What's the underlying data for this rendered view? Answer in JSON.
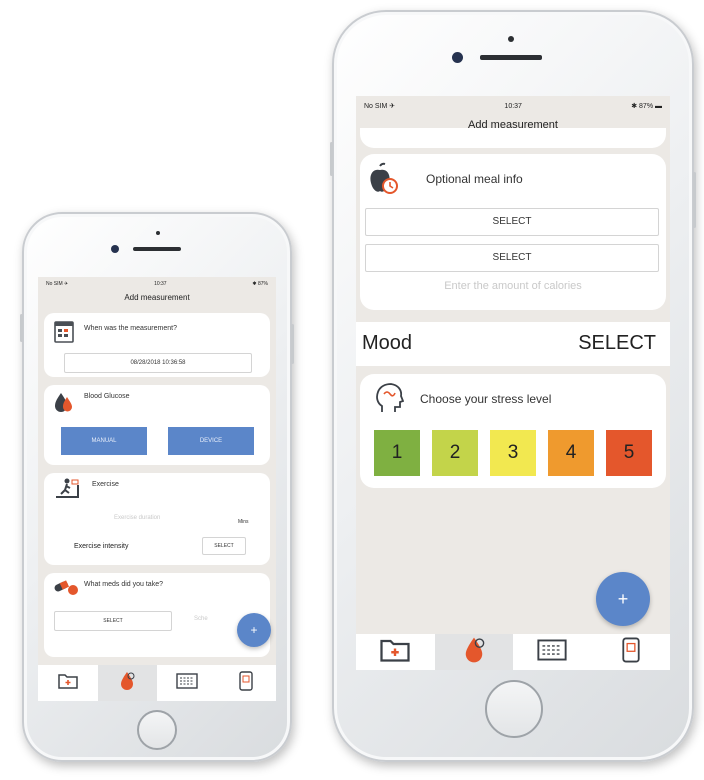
{
  "colors": {
    "accent": "#5b86c9",
    "stress_1": "#7fb041",
    "stress_2": "#c3d44a",
    "stress_3": "#f2e850",
    "stress_4": "#ef9a2e",
    "stress_5": "#e4572c"
  },
  "icons": [
    "folder-plus-icon",
    "blood-drop-icon",
    "calendar-grid-icon",
    "phone-report-icon",
    "calendar-clipboard-icon",
    "glucose-drops-icon",
    "treadmill-icon",
    "pills-icon",
    "apple-clock-icon",
    "head-stress-icon",
    "plus-icon"
  ],
  "small_phone": {
    "status": {
      "carrier": "No SIM ✈",
      "time": "10:37",
      "battery": "✱ 87%"
    },
    "title": "Add measurement",
    "measurement": {
      "question": "When was the measurement?",
      "datetime": "08/28/2018 10:36:58"
    },
    "glucose": {
      "label": "Blood Glucose",
      "manual": "MANUAL",
      "device": "DEVICE"
    },
    "exercise": {
      "label": "Exercise",
      "duration_placeholder": "Exercise duration",
      "unit": "Mins",
      "intensity_label": "Exercise intensity",
      "select": "SELECT"
    },
    "meds": {
      "question": "What meds did you take?",
      "select": "SELECT",
      "partial": "Sche"
    },
    "fab": "+"
  },
  "large_phone": {
    "status": {
      "carrier": "No SIM ✈",
      "time": "10:37",
      "battery": "✱ 87% ▬"
    },
    "title": "Add measurement",
    "meal": {
      "label": "Optional meal info",
      "select_1": "SELECT",
      "select_2": "SELECT",
      "calories_placeholder": "Enter the amount of calories"
    },
    "mood": {
      "label": "Mood",
      "select": "SELECT"
    },
    "stress": {
      "label": "Choose your stress level",
      "levels": [
        "1",
        "2",
        "3",
        "4",
        "5"
      ]
    },
    "fab": "+"
  }
}
